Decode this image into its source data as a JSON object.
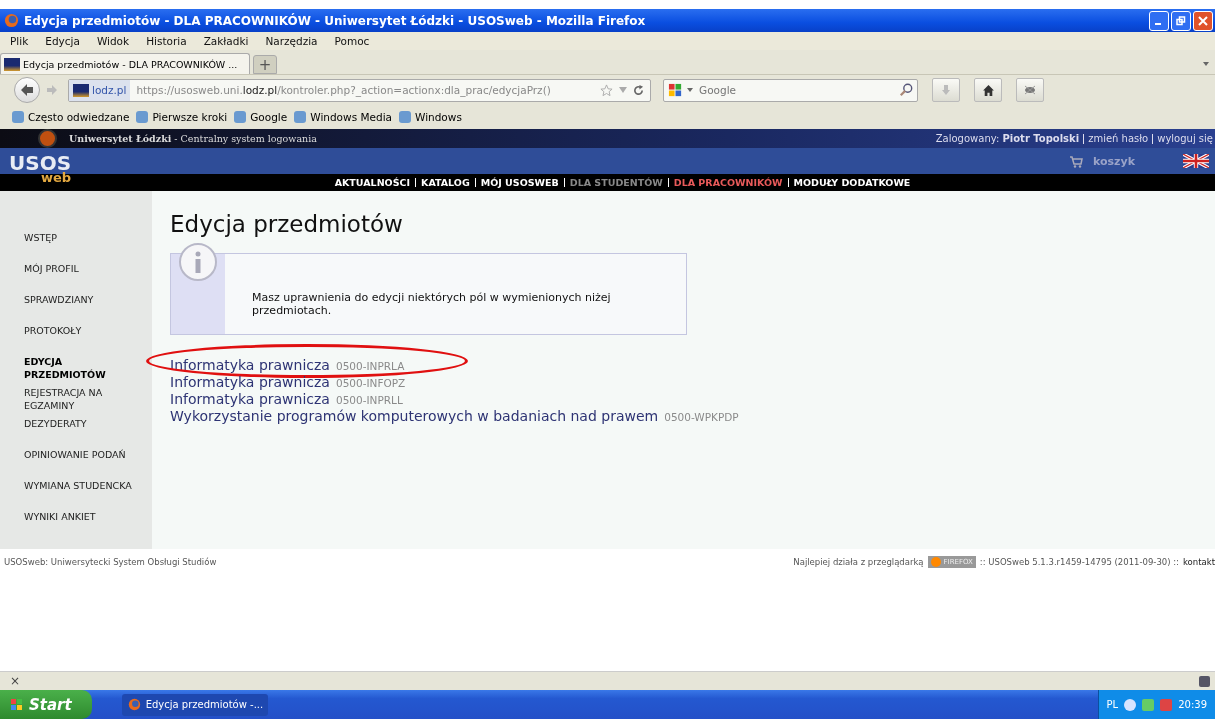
{
  "window": {
    "title": "Edycja przedmiotów - DLA PRACOWNIKÓW - Uniwersytet Łódzki - USOSweb - Mozilla Firefox"
  },
  "menu": [
    "Plik",
    "Edycja",
    "Widok",
    "Historia",
    "Zakładki",
    "Narzędzia",
    "Pomoc"
  ],
  "tabs": [
    {
      "label": "Edycja przedmiotów - DLA PRACOWNIKÓW ...",
      "selected": true
    }
  ],
  "new_tab": "+",
  "address": {
    "site": "lodz.pl",
    "url": "https://usosweb.uni.**lodz.pl**/kontroler.php?_action=actionx:dla_prac/edycjaPrz()"
  },
  "search": {
    "placeholder": "Google"
  },
  "bookmarks": [
    "Często odwiedzane",
    "Pierwsze kroki",
    "Google",
    "Windows Media",
    "Windows"
  ],
  "site": {
    "university": "**Uniwersytet Łódzki** - Centralny system logowania",
    "user": "Zalogowany: **Piotr Topolski**",
    "user_links": [
      "zmień hasło",
      "wyloguj się"
    ],
    "logo_top": "USOS",
    "logo_bottom": "web",
    "cart": "koszyk"
  },
  "nav": [
    {
      "label": "AKTUALNOŚCI",
      "selected": false,
      "disabled": false
    },
    {
      "label": "KATALOG",
      "selected": false,
      "disabled": false
    },
    {
      "label": "MÓJ USOSWEB",
      "selected": false,
      "disabled": false
    },
    {
      "label": "DLA STUDENTÓW",
      "selected": false,
      "disabled": true
    },
    {
      "label": "DLA PRACOWNIKÓW",
      "selected": true,
      "disabled": false
    },
    {
      "label": "MODUŁY DODATKOWE",
      "selected": false,
      "disabled": false
    }
  ],
  "sidebar": {
    "items": [
      {
        "label": "WSTĘP",
        "selected": false
      },
      {
        "label": "MÓJ PROFIL",
        "selected": false
      },
      {
        "label": "SPRAWDZIANY",
        "selected": false
      },
      {
        "label": "PROTOKOŁY",
        "selected": false
      },
      {
        "label": "EDYCJA PRZEDMIOTÓW",
        "selected": true
      },
      {
        "label": "REJESTRACJA NA EGZAMINY",
        "selected": false
      },
      {
        "label": "DEZYDERATY",
        "selected": false
      },
      {
        "label": "OPINIOWANIE PODAŃ",
        "selected": false
      },
      {
        "label": "WYMIANA STUDENCKA",
        "selected": false
      },
      {
        "label": "WYNIKI ANKIET",
        "selected": false
      }
    ]
  },
  "heading": "Edycja przedmiotów",
  "info": "Masz uprawnienia do edycji niektórych pól w wymienionych niżej przedmiotach.",
  "courses": [
    {
      "name": "Informatyka prawnicza",
      "code": "0500-INPRLA",
      "circled": true
    },
    {
      "name": "Informatyka prawnicza",
      "code": "0500-INFOPZ",
      "circled": false
    },
    {
      "name": "Informatyka prawnicza",
      "code": "0500-INPRLL",
      "circled": false
    },
    {
      "name": "Wykorzystanie programów komputerowych w badaniach nad prawem",
      "code": "0500-WPKPDP",
      "circled": false
    }
  ],
  "footer": {
    "left": "USOSweb: Uniwersytecki System Obsługi Studiów",
    "best": "Najlepiej działa z przeglądarką",
    "badge": "FIREFOX",
    "version": ":: USOSweb 5.1.3.r1459-14795 (2011-09-30) ::",
    "contact": "kontakt"
  },
  "status_bar": {
    "close": "×"
  },
  "taskbar": {
    "start": "Start",
    "task": "Edycja przedmiotów -...",
    "lang": "PL",
    "clock": "20:39"
  }
}
